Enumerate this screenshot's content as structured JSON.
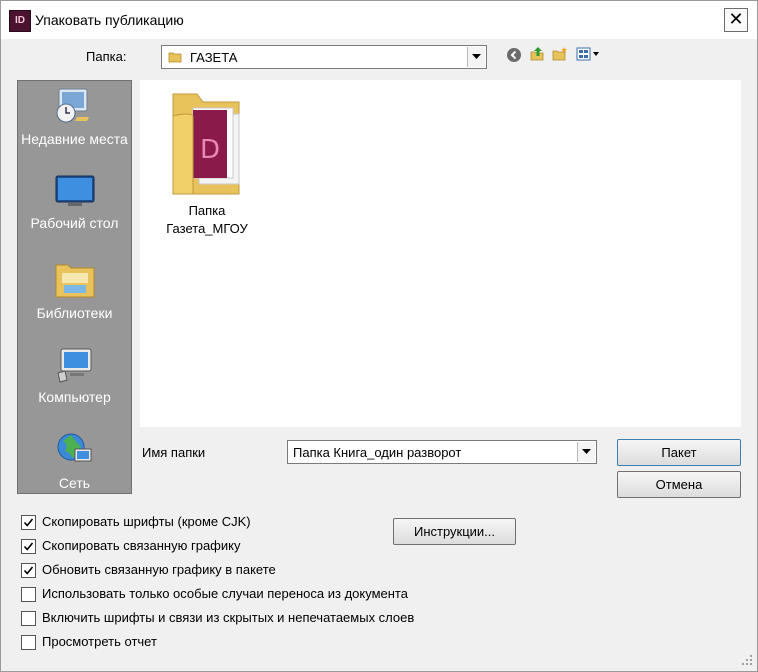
{
  "window": {
    "title": "Упаковать публикацию",
    "app_icon_text": "ID",
    "close_glyph": "✕"
  },
  "folder_bar": {
    "label": "Папка:",
    "current_folder": "ГАЗЕТА",
    "toolbar_icons": [
      "back-icon",
      "up-folder-icon",
      "new-folder-icon",
      "view-menu-icon"
    ]
  },
  "places": [
    {
      "label": "Недавние места",
      "icon": "recent-places-icon"
    },
    {
      "label": "Рабочий стол",
      "icon": "desktop-icon"
    },
    {
      "label": "Библиотеки",
      "icon": "libraries-icon"
    },
    {
      "label": "Компьютер",
      "icon": "computer-icon"
    },
    {
      "label": "Сеть",
      "icon": "network-icon"
    }
  ],
  "files": [
    {
      "name": "Папка Газета_МГОУ",
      "icon": "indesign-folder-icon"
    }
  ],
  "folder_name": {
    "label": "Имя папки",
    "value": "Папка Книга_один разворот"
  },
  "buttons": {
    "package": "Пакет",
    "cancel": "Отмена",
    "instructions": "Инструкции..."
  },
  "options": [
    {
      "label": "Скопировать шрифты (кроме CJK)",
      "checked": true
    },
    {
      "label": "Скопировать связанную графику",
      "checked": true
    },
    {
      "label": "Обновить связанную графику в пакете",
      "checked": true
    },
    {
      "label": "Использовать только особые случаи переноса из документа",
      "checked": false
    },
    {
      "label": "Включить шрифты и связи из скрытых и непечатаемых слоев",
      "checked": false
    },
    {
      "label": "Просмотреть отчет",
      "checked": false
    }
  ],
  "colors": {
    "places_bg": "#979797",
    "accent_border": "#3c7fb1",
    "indesign_brand": "#4a1330"
  }
}
